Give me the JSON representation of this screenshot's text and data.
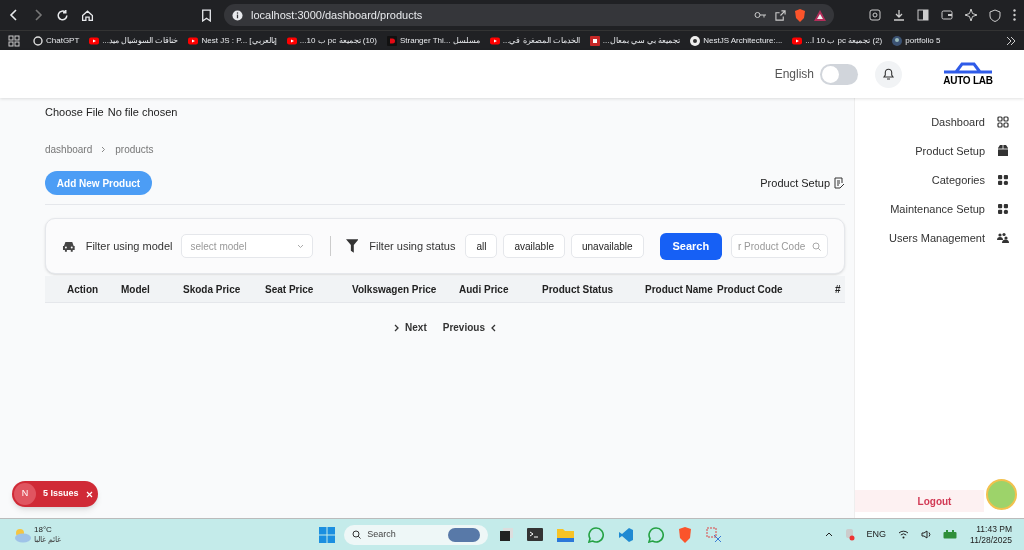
{
  "browser": {
    "address": "localhost:3000/dashboard/products",
    "bookmarks": [
      {
        "label": "ChatGPT",
        "kind": "chatgpt"
      },
      {
        "label": "خناقات السوشيال ميد...",
        "kind": "video"
      },
      {
        "label": "Nest JS : P... [بالعربي]",
        "kind": "video"
      },
      {
        "label": "(10) تجميعة pc ب 10...",
        "kind": "video"
      },
      {
        "label": "Stranger Thi... مسلسل",
        "kind": "dark-badge"
      },
      {
        "label": "الخدمات المصغرة في...",
        "kind": "video"
      },
      {
        "label": "تجميعة بي سي بمعال...",
        "kind": "red-badge"
      },
      {
        "label": "NestJS Architecture:...",
        "kind": "light-circle"
      },
      {
        "label": "(2) تجميعة pc ب 10 ا...",
        "kind": "video"
      },
      {
        "label": "portfolio 5",
        "kind": "dark-circle"
      }
    ]
  },
  "header": {
    "language_toggle": {
      "label": "English",
      "on": false
    },
    "logo": "AUTO LAB"
  },
  "file_input": {
    "button": "Choose File",
    "status": "No file chosen"
  },
  "breadcrumb": [
    "dashboard",
    "products"
  ],
  "add_button": "Add New Product",
  "section_title": "Product Setup",
  "filters": {
    "model_label": "Filter using model",
    "model_placeholder": "select model",
    "status_label": "Filter using status",
    "status_options": [
      "all",
      "available",
      "unavailable"
    ],
    "search_button": "Search",
    "code_placeholder": "r Product Code"
  },
  "table": {
    "columns": [
      "Action",
      "Model",
      "Skoda Price",
      "Seat Price",
      "Volkswagen Price",
      "Audi Price",
      "Product Status",
      "Product Name",
      "Product Code",
      "#"
    ]
  },
  "pagination": {
    "next": "Next",
    "previous": "Previous"
  },
  "sidebar": {
    "items": [
      "Dashboard",
      "Product Setup",
      "Categories",
      "Maintenance Setup",
      "Users Management"
    ],
    "logout": "Logout"
  },
  "issues_badge": {
    "logo": "N",
    "label": "5 Issues"
  },
  "taskbar": {
    "weather": {
      "temperature": "18°C",
      "condition": "غائم غالبا"
    },
    "search": "Search",
    "language": "ENG",
    "time": "11:43 PM",
    "date": "11/28/2025"
  }
}
